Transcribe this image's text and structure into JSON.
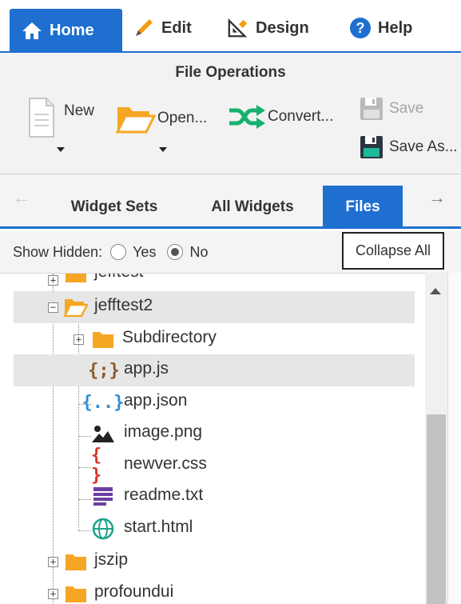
{
  "toptabs": {
    "home": "Home",
    "edit": "Edit",
    "design": "Design",
    "help": "Help"
  },
  "ribbon": {
    "group_title": "File Operations",
    "new_label": "New",
    "open_label": "Open...",
    "convert_label": "Convert...",
    "save_label": "Save",
    "save_as_label": "Save As..."
  },
  "tabs": {
    "widget_sets": "Widget Sets",
    "all_widgets": "All Widgets",
    "files": "Files"
  },
  "hidden": {
    "label": "Show Hidden:",
    "yes": "Yes",
    "no": "No",
    "selected": "No"
  },
  "collapse_all": "Collapse All",
  "tree": {
    "items": [
      {
        "label": "jefftest",
        "type": "folder"
      },
      {
        "label": "jefftest2",
        "type": "folder-open"
      },
      {
        "label": "Subdirectory",
        "type": "folder"
      },
      {
        "label": "app.js",
        "type": "js"
      },
      {
        "label": "app.json",
        "type": "json"
      },
      {
        "label": "image.png",
        "type": "image"
      },
      {
        "label": "newver.css",
        "type": "css"
      },
      {
        "label": "readme.txt",
        "type": "text"
      },
      {
        "label": "start.html",
        "type": "html"
      },
      {
        "label": "jszip",
        "type": "folder"
      },
      {
        "label": "profoundui",
        "type": "folder"
      }
    ]
  },
  "colors": {
    "accent": "#1e6fd0",
    "folder": "#f5a623",
    "js_brace": "#8b5a2b",
    "json_brace": "#2f8fd8",
    "css_brace": "#d9342b",
    "text_icon": "#6b3fa0",
    "html_globe": "#1aa38a"
  }
}
